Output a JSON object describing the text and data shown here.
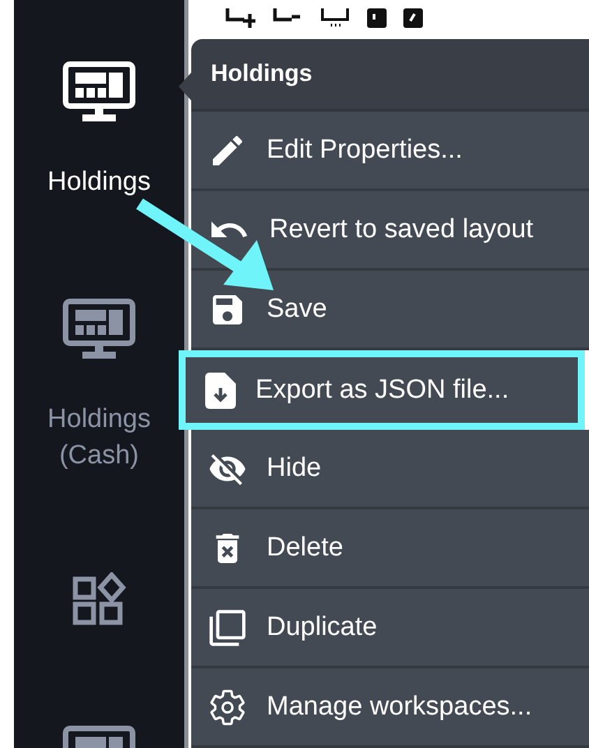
{
  "sidebar": {
    "items": [
      {
        "kind": "monitor",
        "label": "Holdings",
        "selected": true
      },
      {
        "kind": "monitor",
        "label": "Holdings (Cash)",
        "selected": false
      },
      {
        "kind": "widgets",
        "selected": false
      },
      {
        "kind": "monitor",
        "selected": false
      }
    ]
  },
  "menu": {
    "title": "Holdings",
    "items": [
      {
        "kind": "edit",
        "label": "Edit Properties...",
        "highlighted": false
      },
      {
        "kind": "revert",
        "label": "Revert to saved layout",
        "highlighted": false
      },
      {
        "kind": "save",
        "label": "Save",
        "highlighted": false
      },
      {
        "kind": "export",
        "label": "Export as JSON file...",
        "highlighted": true
      },
      {
        "kind": "hide",
        "label": "Hide",
        "highlighted": false
      },
      {
        "kind": "delete",
        "label": "Delete",
        "highlighted": false
      },
      {
        "kind": "duplicate",
        "label": "Duplicate",
        "highlighted": false
      },
      {
        "kind": "manage",
        "label": "Manage workspaces...",
        "highlighted": false
      }
    ]
  }
}
